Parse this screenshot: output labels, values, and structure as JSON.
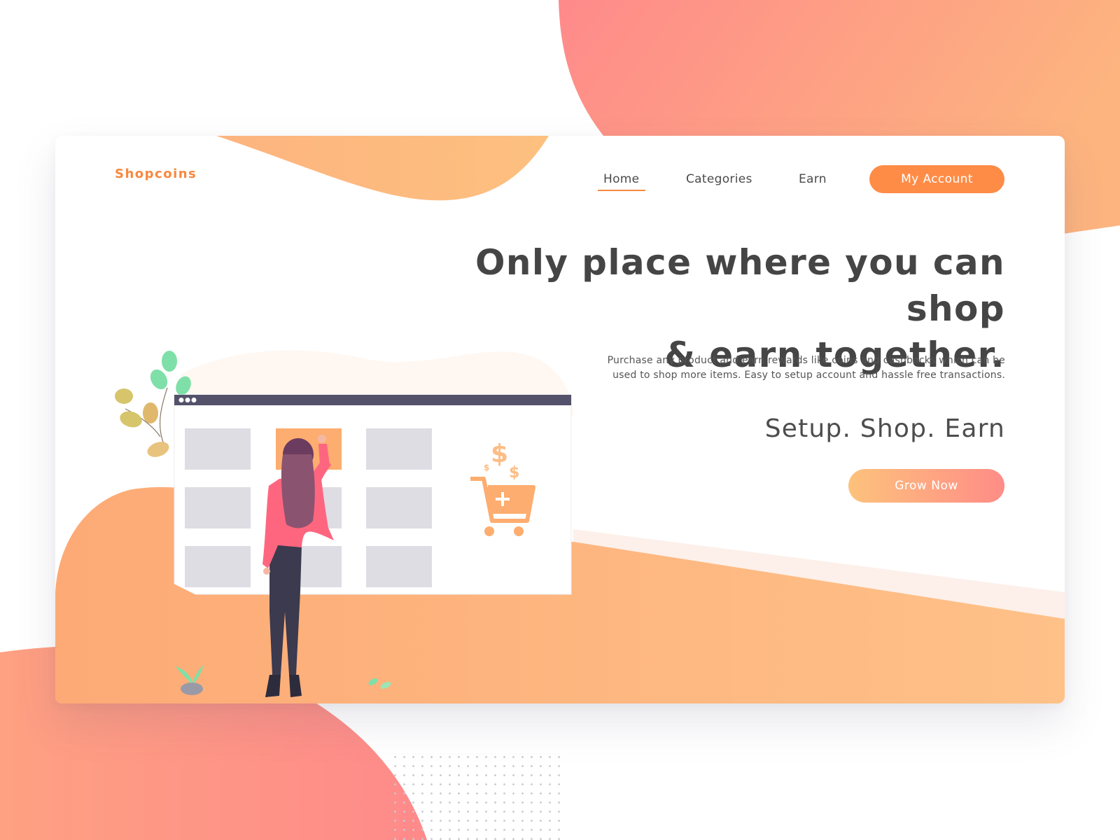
{
  "brand": {
    "name": "Shopcoins"
  },
  "nav": {
    "items": [
      {
        "label": "Home",
        "active": true
      },
      {
        "label": "Categories",
        "active": false
      },
      {
        "label": "Earn",
        "active": false
      }
    ],
    "account_button": "My Account"
  },
  "hero": {
    "headline_line1": "Only place where you can shop",
    "headline_line2": "& earn together.",
    "subtext_line1": "Purchase any product and earn rewards like coins and cashbacks which can be",
    "subtext_line2": "used to shop more items. Easy to setup account and hassle free transactions.",
    "tagline": "Setup. Shop. Earn",
    "cta": "Grow Now"
  },
  "colors": {
    "accent": "#fe8c47",
    "brand": "#f7883e",
    "gradient_start": "#fdc27c",
    "gradient_end": "#fe8c87",
    "heading": "#454545"
  },
  "icons": [
    "shopping-cart-icon",
    "dollar-icon"
  ]
}
